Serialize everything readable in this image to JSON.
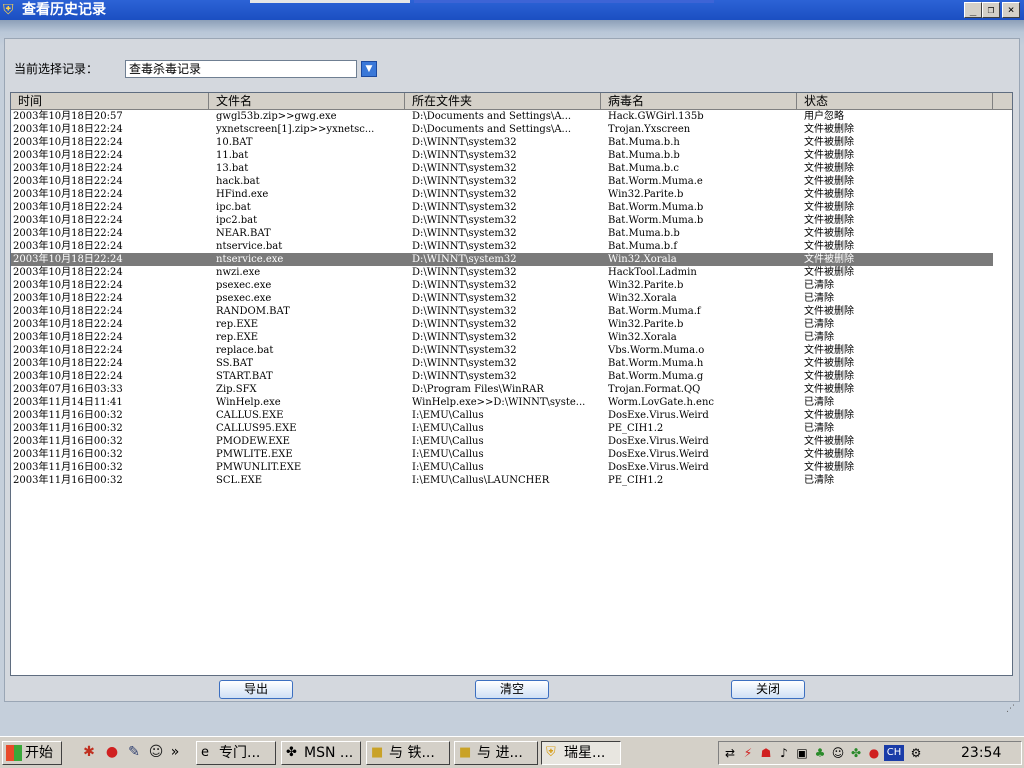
{
  "window": {
    "title": "查看历史记录"
  },
  "selector": {
    "label": "当前选择记录：",
    "value": "查毒杀毒记录"
  },
  "columns": [
    "时间",
    "文件名",
    "所在文件夹",
    "病毒名",
    "状态"
  ],
  "rows": [
    [
      "2003年10月18日20:57",
      "gwgl53b.zip>>gwg.exe",
      "D:\\Documents and Settings\\A...",
      "Hack.GWGirl.135b",
      "用户忽略"
    ],
    [
      "2003年10月18日22:24",
      "yxnetscreen[1].zip>>yxnetsc...",
      "D:\\Documents and Settings\\A...",
      "Trojan.Yxscreen",
      "文件被删除"
    ],
    [
      "2003年10月18日22:24",
      "10.BAT",
      "D:\\WINNT\\system32",
      "Bat.Muma.b.h",
      "文件被删除"
    ],
    [
      "2003年10月18日22:24",
      "11.bat",
      "D:\\WINNT\\system32",
      "Bat.Muma.b.b",
      "文件被删除"
    ],
    [
      "2003年10月18日22:24",
      "13.bat",
      "D:\\WINNT\\system32",
      "Bat.Muma.b.c",
      "文件被删除"
    ],
    [
      "2003年10月18日22:24",
      "hack.bat",
      "D:\\WINNT\\system32",
      "Bat.Worm.Muma.e",
      "文件被删除"
    ],
    [
      "2003年10月18日22:24",
      "HFind.exe",
      "D:\\WINNT\\system32",
      "Win32.Parite.b",
      "文件被删除"
    ],
    [
      "2003年10月18日22:24",
      "ipc.bat",
      "D:\\WINNT\\system32",
      "Bat.Worm.Muma.b",
      "文件被删除"
    ],
    [
      "2003年10月18日22:24",
      "ipc2.bat",
      "D:\\WINNT\\system32",
      "Bat.Worm.Muma.b",
      "文件被删除"
    ],
    [
      "2003年10月18日22:24",
      "NEAR.BAT",
      "D:\\WINNT\\system32",
      "Bat.Muma.b.b",
      "文件被删除"
    ],
    [
      "2003年10月18日22:24",
      "ntservice.bat",
      "D:\\WINNT\\system32",
      "Bat.Muma.b.f",
      "文件被删除"
    ],
    [
      "2003年10月18日22:24",
      "ntservice.exe",
      "D:\\WINNT\\system32",
      "Win32.Xorala",
      "文件被删除"
    ],
    [
      "2003年10月18日22:24",
      "nwzi.exe",
      "D:\\WINNT\\system32",
      "HackTool.Ladmin",
      "文件被删除"
    ],
    [
      "2003年10月18日22:24",
      "psexec.exe",
      "D:\\WINNT\\system32",
      "Win32.Parite.b",
      "已清除"
    ],
    [
      "2003年10月18日22:24",
      "psexec.exe",
      "D:\\WINNT\\system32",
      "Win32.Xorala",
      "已清除"
    ],
    [
      "2003年10月18日22:24",
      "RANDOM.BAT",
      "D:\\WINNT\\system32",
      "Bat.Worm.Muma.f",
      "文件被删除"
    ],
    [
      "2003年10月18日22:24",
      "rep.EXE",
      "D:\\WINNT\\system32",
      "Win32.Parite.b",
      "已清除"
    ],
    [
      "2003年10月18日22:24",
      "rep.EXE",
      "D:\\WINNT\\system32",
      "Win32.Xorala",
      "已清除"
    ],
    [
      "2003年10月18日22:24",
      "replace.bat",
      "D:\\WINNT\\system32",
      "Vbs.Worm.Muma.o",
      "文件被删除"
    ],
    [
      "2003年10月18日22:24",
      "SS.BAT",
      "D:\\WINNT\\system32",
      "Bat.Worm.Muma.h",
      "文件被删除"
    ],
    [
      "2003年10月18日22:24",
      "START.BAT",
      "D:\\WINNT\\system32",
      "Bat.Worm.Muma.g",
      "文件被删除"
    ],
    [
      "2003年07月16日03:33",
      "Zip.SFX",
      "D:\\Program Files\\WinRAR",
      "Trojan.Format.QQ",
      "文件被删除"
    ],
    [
      "2003年11月14日11:41",
      "WinHelp.exe",
      "WinHelp.exe>>D:\\WINNT\\syste...",
      "Worm.LovGate.h.enc",
      "已清除"
    ],
    [
      "2003年11月16日00:32",
      "CALLUS.EXE",
      "I:\\EMU\\Callus",
      "DosExe.Virus.Weird",
      "文件被删除"
    ],
    [
      "2003年11月16日00:32",
      "CALLUS95.EXE",
      "I:\\EMU\\Callus",
      "PE_CIH1.2",
      "已清除"
    ],
    [
      "2003年11月16日00:32",
      "PMODEW.EXE",
      "I:\\EMU\\Callus",
      "DosExe.Virus.Weird",
      "文件被删除"
    ],
    [
      "2003年11月16日00:32",
      "PMWLITE.EXE",
      "I:\\EMU\\Callus",
      "DosExe.Virus.Weird",
      "文件被删除"
    ],
    [
      "2003年11月16日00:32",
      "PMWUNLIT.EXE",
      "I:\\EMU\\Callus",
      "DosExe.Virus.Weird",
      "文件被删除"
    ],
    [
      "2003年11月16日00:32",
      "SCL.EXE",
      "I:\\EMU\\Callus\\LAUNCHER",
      "PE_CIH1.2",
      "已清除"
    ]
  ],
  "selected_row": 11,
  "buttons": {
    "export": "导出",
    "clear": "清空",
    "close": "关闭"
  },
  "taskbar": {
    "start": "开始",
    "tasks": [
      "专门...",
      "MSN ...",
      "与 铁...",
      "与 进...",
      "瑞星..."
    ],
    "clock": "23:54",
    "tray_lang": "CH"
  },
  "colors": {
    "title_bar": "#1b4fc2",
    "selection": "#7a7a7a",
    "button_border": "#3c6fc0"
  }
}
